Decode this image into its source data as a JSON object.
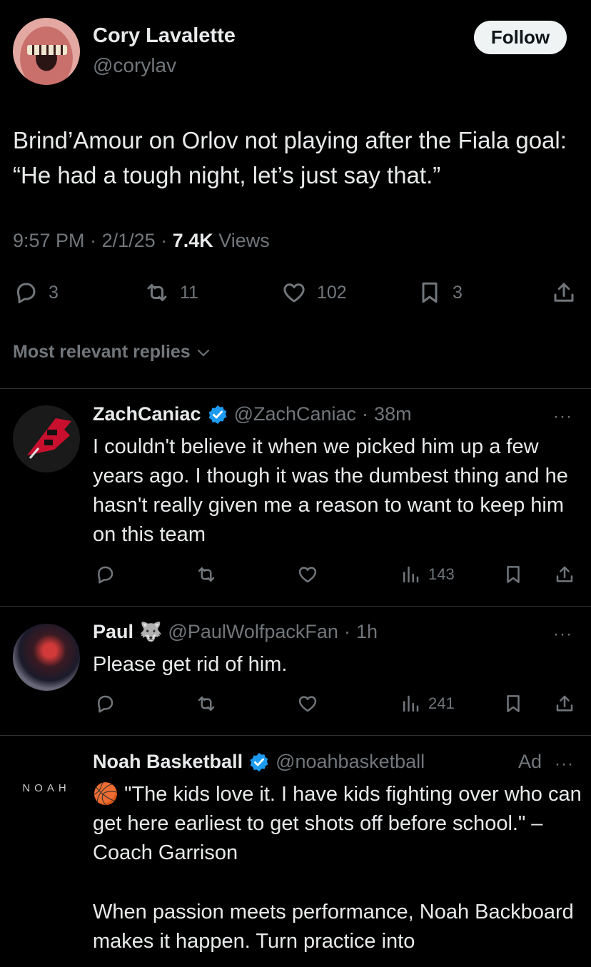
{
  "tweet": {
    "author_name": "Cory Lavalette",
    "author_handle": "@corylav",
    "follow_label": "Follow",
    "text": "Brind’Amour on Orlov not playing after the Fiala goal: “He had a tough night, let’s just say that.”",
    "time": "9:57 PM",
    "date": "2/1/25",
    "views_count": "7.4K",
    "views_label": "Views",
    "replies": "3",
    "reposts": "11",
    "likes": "102",
    "bookmarks": "3"
  },
  "sort_label": "Most relevant replies",
  "replies": [
    {
      "name": "ZachCaniac",
      "verified": true,
      "handle": "@ZachCaniac",
      "time": "38m",
      "more": "···",
      "text": "I couldn't believe it when we picked him up a few years ago.  I though it was the dumbest thing and he hasn't really given me a reason to want to keep him on this team",
      "views": "143"
    },
    {
      "name": "Paul",
      "emoji": "🐺",
      "handle": "@PaulWolfpackFan",
      "time": "1h",
      "more": "···",
      "text": "Please get rid of him.",
      "views": "241"
    },
    {
      "name": "Noah Basketball",
      "verified": true,
      "handle": "@noahbasketball",
      "ad_label": "Ad",
      "more": "···",
      "logo": "NOAH",
      "emoji": "🏀",
      "text1": " \"The kids love it. I have kids fighting over who can get here earliest to get shots off before school.\" – Coach Garrison",
      "text2": "When passion meets performance, Noah Backboard makes it happen. Turn practice into"
    }
  ],
  "colors": {
    "background": "#000000",
    "text": "#e7e9ea",
    "muted": "#71767b",
    "verified": "#1d9bf0",
    "divider": "#2f3336"
  }
}
